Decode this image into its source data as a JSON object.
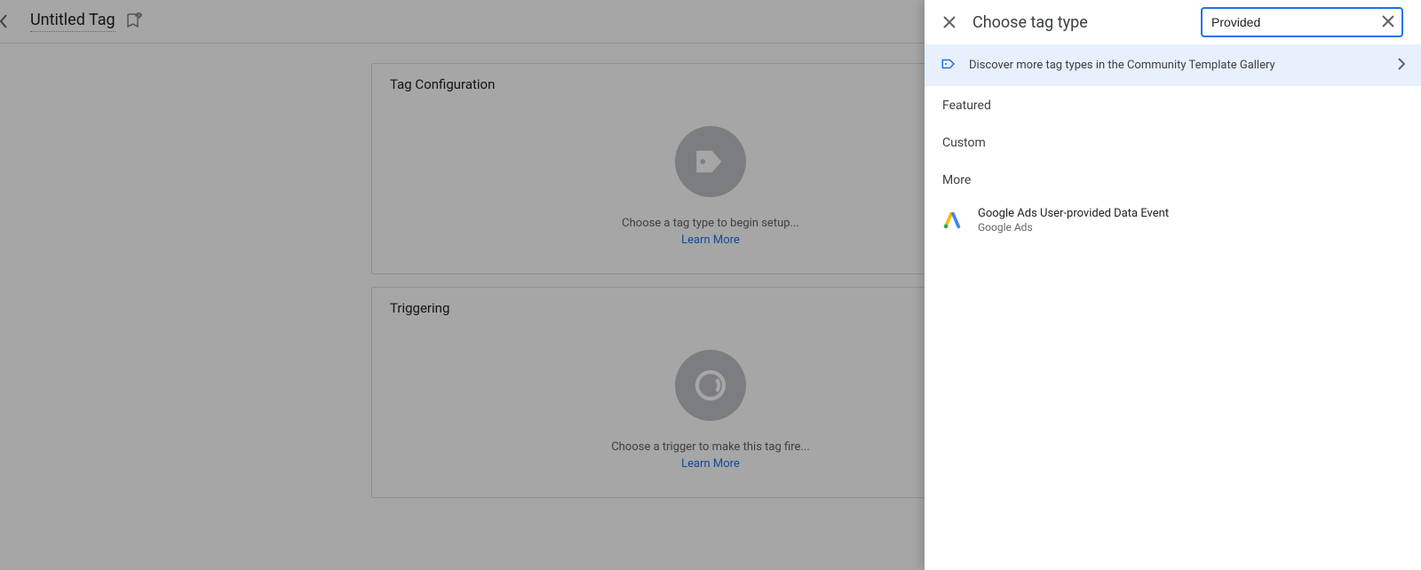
{
  "header": {
    "tag_title": "Untitled Tag"
  },
  "tag_config": {
    "heading": "Tag Configuration",
    "hint": "Choose a tag type to begin setup...",
    "learn_more": "Learn More"
  },
  "triggering": {
    "heading": "Triggering",
    "hint": "Choose a trigger to make this tag fire...",
    "learn_more": "Learn More"
  },
  "panel": {
    "title": "Choose tag type",
    "search_value": "Provided",
    "discover": "Discover more tag types in the Community Template Gallery",
    "sections": {
      "featured": "Featured",
      "custom": "Custom",
      "more": "More"
    },
    "results": [
      {
        "title": "Google Ads User-provided Data Event",
        "subtitle": "Google Ads"
      }
    ]
  }
}
